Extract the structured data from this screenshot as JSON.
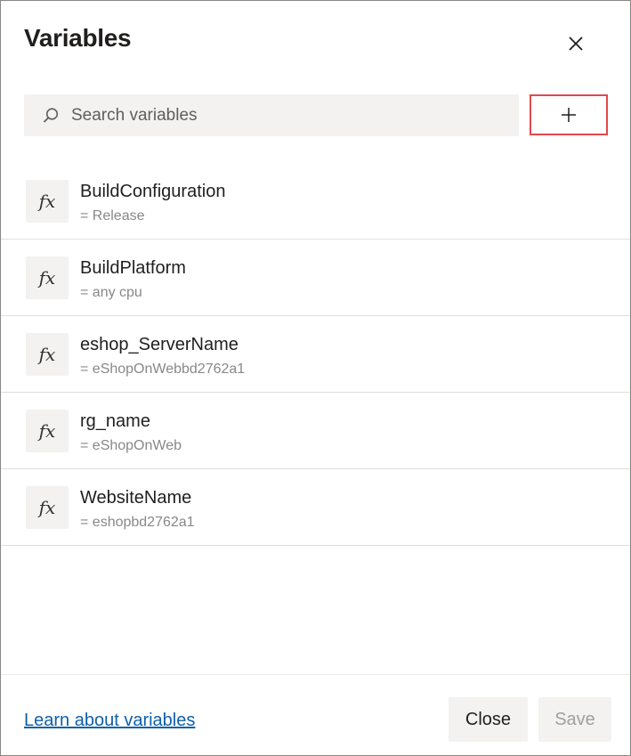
{
  "dialog": {
    "title": "Variables"
  },
  "search": {
    "placeholder": "Search variables",
    "value": ""
  },
  "variables": [
    {
      "icon": "fx-icon",
      "glyph": "fx",
      "name": "BuildConfiguration",
      "value": "= Release"
    },
    {
      "icon": "fx-icon",
      "glyph": "fx",
      "name": "BuildPlatform",
      "value": "= any cpu"
    },
    {
      "icon": "fx-icon",
      "glyph": "fx",
      "name": "eshop_ServerName",
      "value": "= eShopOnWebbd2762a1"
    },
    {
      "icon": "fx-icon",
      "glyph": "fx",
      "name": "rg_name",
      "value": "= eShopOnWeb"
    },
    {
      "icon": "fx-icon",
      "glyph": "fx",
      "name": "WebsiteName",
      "value": "= eshopbd2762a1"
    }
  ],
  "footer": {
    "learn_link": "Learn about variables",
    "close_label": "Close",
    "save_label": "Save",
    "save_disabled": true
  },
  "colors": {
    "link": "#0f5fa8",
    "highlight_border": "#e0484b",
    "surface": "#f3f2f1"
  }
}
